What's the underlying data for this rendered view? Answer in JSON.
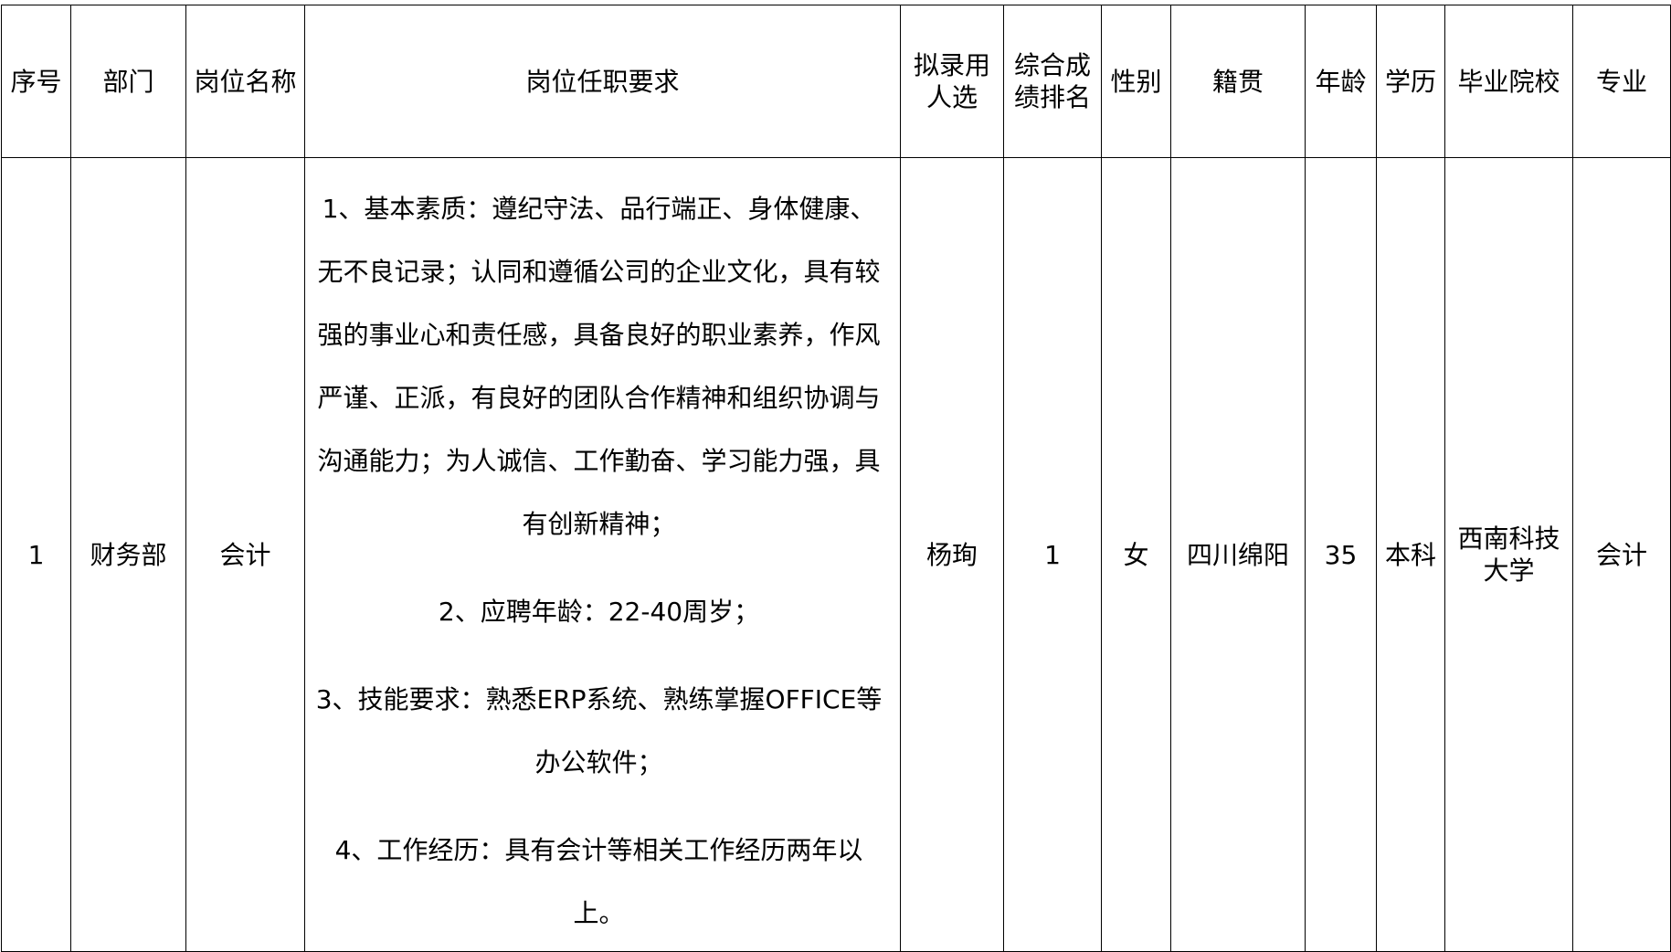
{
  "headers": {
    "seq": "序号",
    "dept": "部门",
    "position": "岗位名称",
    "requirements": "岗位任职要求",
    "candidate_line1": "拟录用",
    "candidate_line2": "人选",
    "rank_line1": "综合成",
    "rank_line2": "绩排名",
    "gender": "性别",
    "native_place": "籍贯",
    "age": "年龄",
    "education": "学历",
    "school": "毕业院校",
    "major": "专业"
  },
  "row": {
    "seq": "1",
    "dept": "财务部",
    "position": "会计",
    "requirements": [
      "1、基本素质：遵纪守法、品行端正、身体健康、",
      "无不良记录；认同和遵循公司的企业文化，具有较",
      "强的事业心和责任感，具备良好的职业素养，作风",
      "严谨、正派，有良好的团队合作精神和组织协调与",
      "沟通能力；为人诚信、工作勤奋、学习能力强，具",
      "有创新精神；",
      "2、应聘年龄：22-40周岁；",
      "3、技能要求：熟悉ERP系统、熟练掌握OFFICE等",
      "办公软件；",
      "4、工作经历：具有会计等相关工作经历两年以",
      "上。"
    ],
    "candidate": "杨珣",
    "rank": "1",
    "gender": "女",
    "native_place": "四川绵阳",
    "age": "35",
    "education": "本科",
    "school_line1": "西南科技",
    "school_line2": "大学",
    "major": "会计"
  }
}
